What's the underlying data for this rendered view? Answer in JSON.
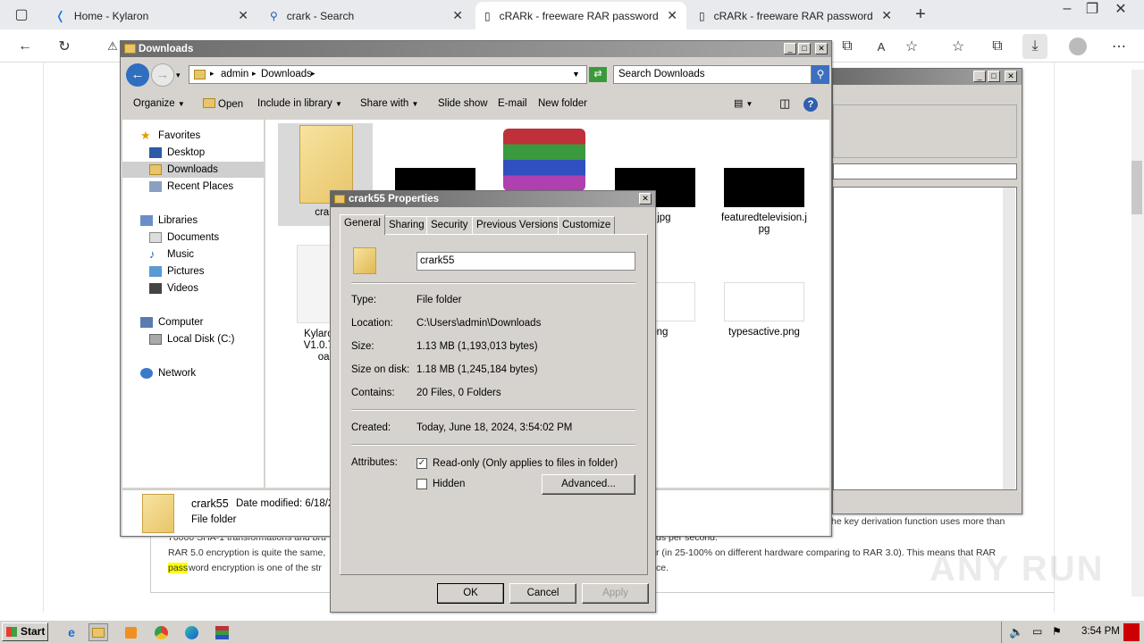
{
  "browser": {
    "tabs": [
      {
        "title": "Home - Kylaron"
      },
      {
        "title": "crark - Search"
      },
      {
        "title": "cRARk - freeware RAR password"
      },
      {
        "title": "cRARk - freeware RAR password"
      }
    ]
  },
  "page": {
    "lines": [
      "he key derivation function uses more than",
      "70000 SHA-1 transformations and bru",
      "ds per second.",
      "RAR 5.0 encryption is quite the same,",
      "r (in 25-100% on different hardware comparing to RAR 3.0). This means that RAR",
      "pass",
      "word encryption is one of the str",
      "ce."
    ]
  },
  "explorer": {
    "title": "Downloads",
    "breadcrumb": [
      "admin",
      "Downloads"
    ],
    "search_placeholder": "Search Downloads",
    "commands": [
      "Organize",
      "Open",
      "Include in library",
      "Share with",
      "Slide show",
      "E-mail",
      "New folder"
    ],
    "nav": {
      "favorites": "Favorites",
      "desktop": "Desktop",
      "downloads": "Downloads",
      "recent": "Recent Places",
      "libraries": "Libraries",
      "documents": "Documents",
      "music": "Music",
      "pictures": "Pictures",
      "videos": "Videos",
      "computer": "Computer",
      "localdisk": "Local Disk (C:)",
      "network": "Network"
    },
    "files": {
      "crark": "crark",
      "jpg1": "are.jpg",
      "featured": "featuredtelevision.jpg",
      "kylaron1": "Kylaron S",
      "kylaron2": "V1.0.7.rar",
      "kylaron3": "oac",
      "png1": "p.png",
      "typesactive": "typesactive.png"
    },
    "details": {
      "name": "crark55",
      "modified": "Date modified: 6/18/2",
      "type": "File folder"
    }
  },
  "props": {
    "title": "crark55 Properties",
    "tabs": [
      "General",
      "Sharing",
      "Security",
      "Previous Versions",
      "Customize"
    ],
    "name": "crark55",
    "type_label": "Type:",
    "type": "File folder",
    "location_label": "Location:",
    "location": "C:\\Users\\admin\\Downloads",
    "size_label": "Size:",
    "size": "1.13 MB (1,193,013 bytes)",
    "sizedisk_label": "Size on disk:",
    "sizedisk": "1.18 MB (1,245,184 bytes)",
    "contains_label": "Contains:",
    "contains": "20 Files, 0 Folders",
    "created_label": "Created:",
    "created": "Today, June 18, 2024, 3:54:02 PM",
    "attributes_label": "Attributes:",
    "readonly": "Read-only (Only applies to files in folder)",
    "hidden": "Hidden",
    "advanced": "Advanced...",
    "ok": "OK",
    "cancel": "Cancel",
    "apply": "Apply"
  },
  "taskbar": {
    "start": "Start",
    "time": "3:54 PM"
  },
  "watermark": "ANY RUN"
}
